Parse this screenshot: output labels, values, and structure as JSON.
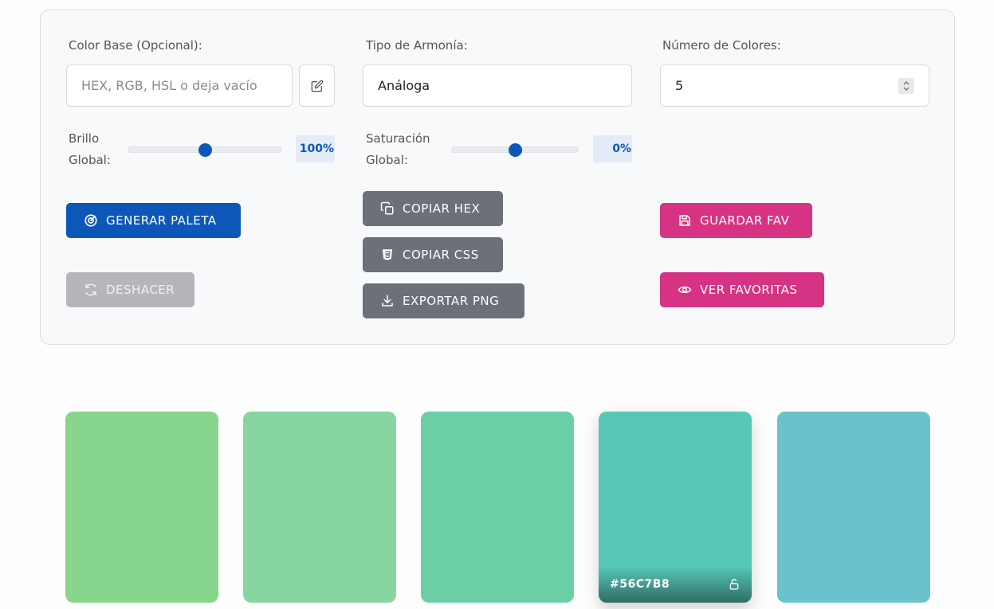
{
  "controls": {
    "base_color": {
      "label": "Color Base (Opcional):",
      "placeholder": "HEX, RGB, HSL o deja vacío",
      "value": ""
    },
    "harmony": {
      "label": "Tipo de Armonía:",
      "value": "Análoga"
    },
    "count": {
      "label": "Número de Colores:",
      "value": "5"
    },
    "brightness": {
      "label_line1": "Brillo",
      "label_line2": "Global:",
      "value_text": "100%",
      "level": 0.5
    },
    "saturation": {
      "label_line1": "Saturación",
      "label_line2": "Global:",
      "value_text": "0%",
      "level": 0.5
    }
  },
  "buttons": {
    "generate": "GENERAR PALETA",
    "undo": "DESHACER",
    "copy_hex": "COPIAR HEX",
    "copy_css": "COPIAR CSS",
    "export_png": "EXPORTAR PNG",
    "save_fav": "GUARDAR FAV",
    "view_favs": "VER FAVORITAS"
  },
  "palette": [
    {
      "color": "#88d68d",
      "hex_label": ""
    },
    {
      "color": "#87d6a2",
      "hex_label": ""
    },
    {
      "color": "#6bcfa6",
      "hex_label": ""
    },
    {
      "color": "#56c7b8",
      "hex_label": "#56C7B8",
      "locked": false
    },
    {
      "color": "#6bc1cc",
      "hex_label": ""
    }
  ],
  "colors": {
    "primary": "#0d57b8",
    "secondary": "#6b7079",
    "pink": "#d63384",
    "disabled": "#b4b6ba"
  }
}
